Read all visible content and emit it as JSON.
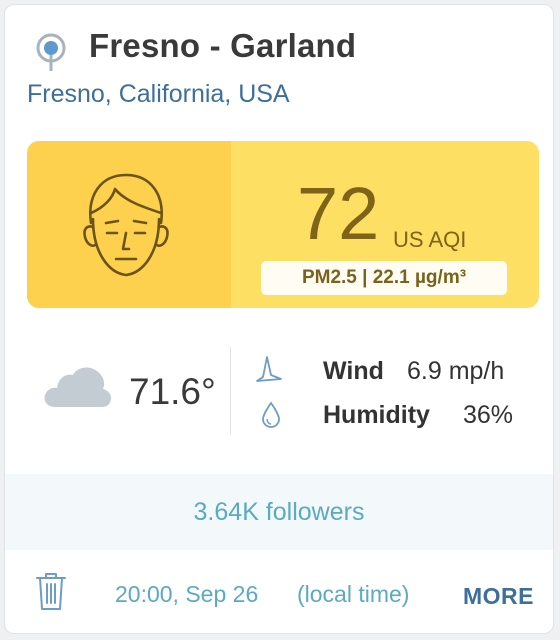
{
  "station": {
    "icon": "station-icon",
    "name": "Fresno - Garland",
    "location": "Fresno, California, USA"
  },
  "aqi": {
    "face_icon": "face-icon",
    "value": "72",
    "unit": "US AQI",
    "pollutant": "PM2.5 | 22.1 µg/m³",
    "colors": {
      "panel": "#fddf64",
      "face_panel": "#fdd04e",
      "text": "#7e6318"
    }
  },
  "weather": {
    "condition_icon": "cloud-icon",
    "temperature": "71.6°",
    "wind": {
      "icon": "wind-icon",
      "label": "Wind",
      "value": "6.9 mp/h"
    },
    "humidity": {
      "icon": "drop-icon",
      "label": "Humidity",
      "value": "36%"
    }
  },
  "followers": "3.64K followers",
  "footer": {
    "delete_icon": "trash-icon",
    "time": "20:00, Sep 26",
    "time_note": "(local time)",
    "more_label": "MORE"
  }
}
